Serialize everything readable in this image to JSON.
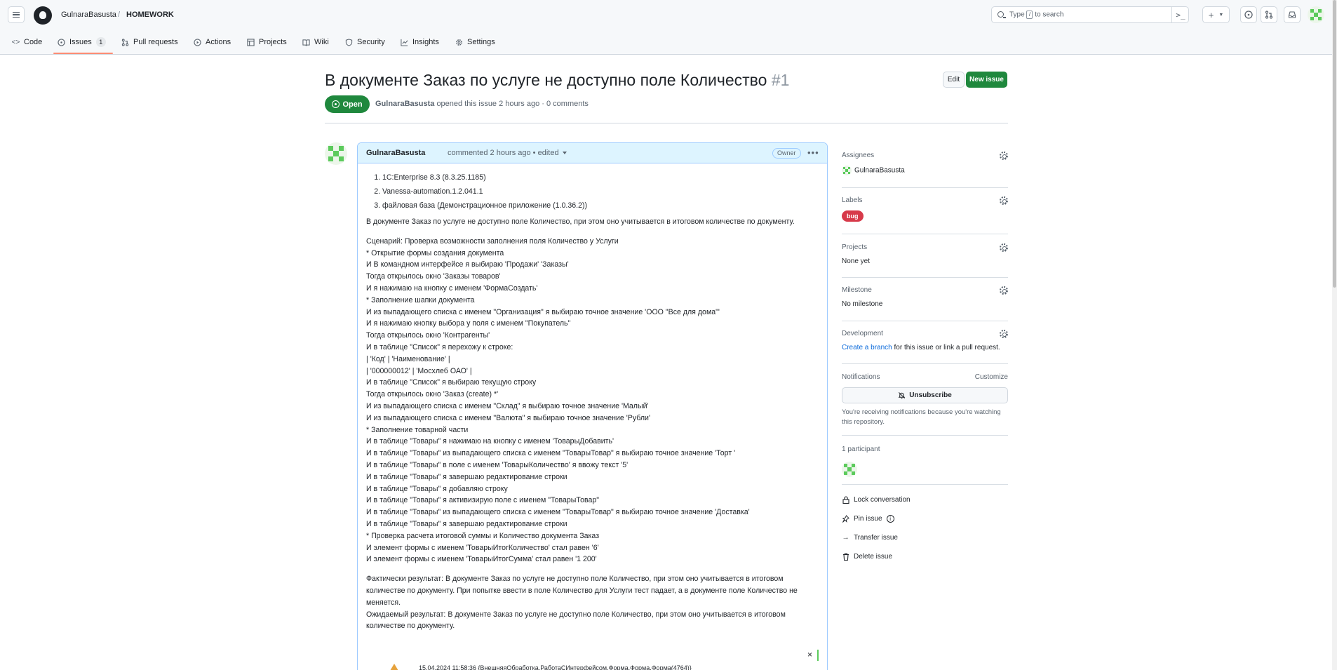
{
  "header": {
    "owner": "GulnaraBasusta",
    "separator": "/",
    "repo": "HOMEWORK",
    "search_placeholder_pre": "Type",
    "search_key": "/",
    "search_placeholder_post": "to search"
  },
  "nav": {
    "code": "Code",
    "issues": "Issues",
    "issues_count": "1",
    "pulls": "Pull requests",
    "actions": "Actions",
    "projects": "Projects",
    "wiki": "Wiki",
    "security": "Security",
    "insights": "Insights",
    "settings": "Settings"
  },
  "issue": {
    "title": "В документе Заказ по услуге не доступно поле Количество",
    "number": "#1",
    "edit_label": "Edit",
    "new_issue_label": "New issue",
    "state": "Open",
    "author": "GulnaraBasusta",
    "meta_rest": "opened this issue 2 hours ago · 0 comments"
  },
  "comment": {
    "author": "GulnaraBasusta",
    "when": "commented 2 hours ago • edited",
    "owner_badge": "Owner",
    "list": [
      "1C:Enterprise 8.3 (8.3.25.1185)",
      "Vanessa-automation.1.2.041.1",
      "файловая база (Демонстрационное приложение (1.0.36.2))"
    ],
    "intro": "В документе Заказ по услуге не доступно поле Количество, при этом оно учитывается в итоговом количестве по документу.",
    "script": [
      "Сценарий: Проверка возможности заполнения поля Количество у Услуги",
      "* Открытие формы создания документа",
      "И В командном интерфейсе я выбираю 'Продажи' 'Заказы'",
      "Тогда открылось окно 'Заказы товаров'",
      "И я нажимаю на кнопку с именем 'ФормаСоздать'",
      "* Заполнение шапки документа",
      "И из выпадающего списка с именем \"Организация\" я выбираю точное значение 'ООО \"Все для дома\"'",
      "И я нажимаю кнопку выбора у поля с именем \"Покупатель\"",
      "Тогда открылось окно 'Контрагенты'",
      "И в таблице \"Список\" я перехожу к строке:",
      "| 'Код' | 'Наименование' |",
      "| '000000012' | 'Мосхлеб ОАО' |",
      "И в таблице \"Список\" я выбираю текущую строку",
      "Тогда открылось окно 'Заказ (create) *'",
      "И из выпадающего списка с именем \"Склад\" я выбираю точное значение 'Малый'",
      "И из выпадающего списка с именем \"Валюта\" я выбираю точное значение 'Рубли'",
      "* Заполнение товарной части",
      "И в таблице \"Товары\" я нажимаю на кнопку с именем 'ТоварыДобавить'",
      "И в таблице \"Товары\" из выпадающего списка с именем \"ТоварыТовар\" я выбираю точное значение 'Торт '",
      "И в таблице \"Товары\" в поле с именем 'ТоварыКоличество' я ввожу текст '5'",
      "И в таблице \"Товары\" я завершаю редактирование строки",
      "И в таблице \"Товары\" я добавляю строку",
      "И в таблице \"Товары\" я активизирую поле с именем \"ТоварыТовар\"",
      "И в таблице \"Товары\" из выпадающего списка с именем \"ТоварыТовар\" я выбираю точное значение 'Доставка'",
      "И в таблице \"Товары\" я завершаю редактирование строки",
      "* Проверка расчета итоговой суммы и Количество документа Заказ",
      "И элемент формы с именем 'ТоварыИтогКоличество' стал равен '6'",
      "И элемент формы с именем 'ТоварыИтогСумма' стал равен '1 200'"
    ],
    "actual": "Фактически результат: В документе Заказ по услуге не доступно поле Количество, при этом оно учитывается в итоговом количестве по документу. При попытке ввести в поле Количество для Услуги тест падает, а в документе поле Количество не меняется.",
    "expected": "Ожидаемый результат: В документе Заказ по услуге не доступно поле Количество, при этом оно учитывается в итоговом количестве по документу.",
    "attachment_close": "×",
    "attachment_text": "15.04.2024 11:58:36 {ВнешняяОбработка.РаботаСИнтерфейсом.Форма.Форма.Форма(4764)}"
  },
  "sidebar": {
    "assignees_heading": "Assignees",
    "assignee": "GulnaraBasusta",
    "labels_heading": "Labels",
    "label": "bug",
    "label_color": "#d73a4a",
    "projects_heading": "Projects",
    "projects_value": "None yet",
    "milestone_heading": "Milestone",
    "milestone_value": "No milestone",
    "development_heading": "Development",
    "dev_link": "Create a branch",
    "dev_rest": "for this issue or link a pull request.",
    "notifications_heading": "Notifications",
    "customize": "Customize",
    "unsubscribe": "Unsubscribe",
    "notif_text": "You're receiving notifications because you're watching this repository.",
    "participants": "1 participant",
    "lock": "Lock conversation",
    "pin": "Pin issue",
    "transfer": "Transfer issue",
    "delete": "Delete issue"
  },
  "colors": {
    "accent_green": "#1f883d",
    "link_blue": "#0969da",
    "tab_underline": "#fd8c73"
  }
}
